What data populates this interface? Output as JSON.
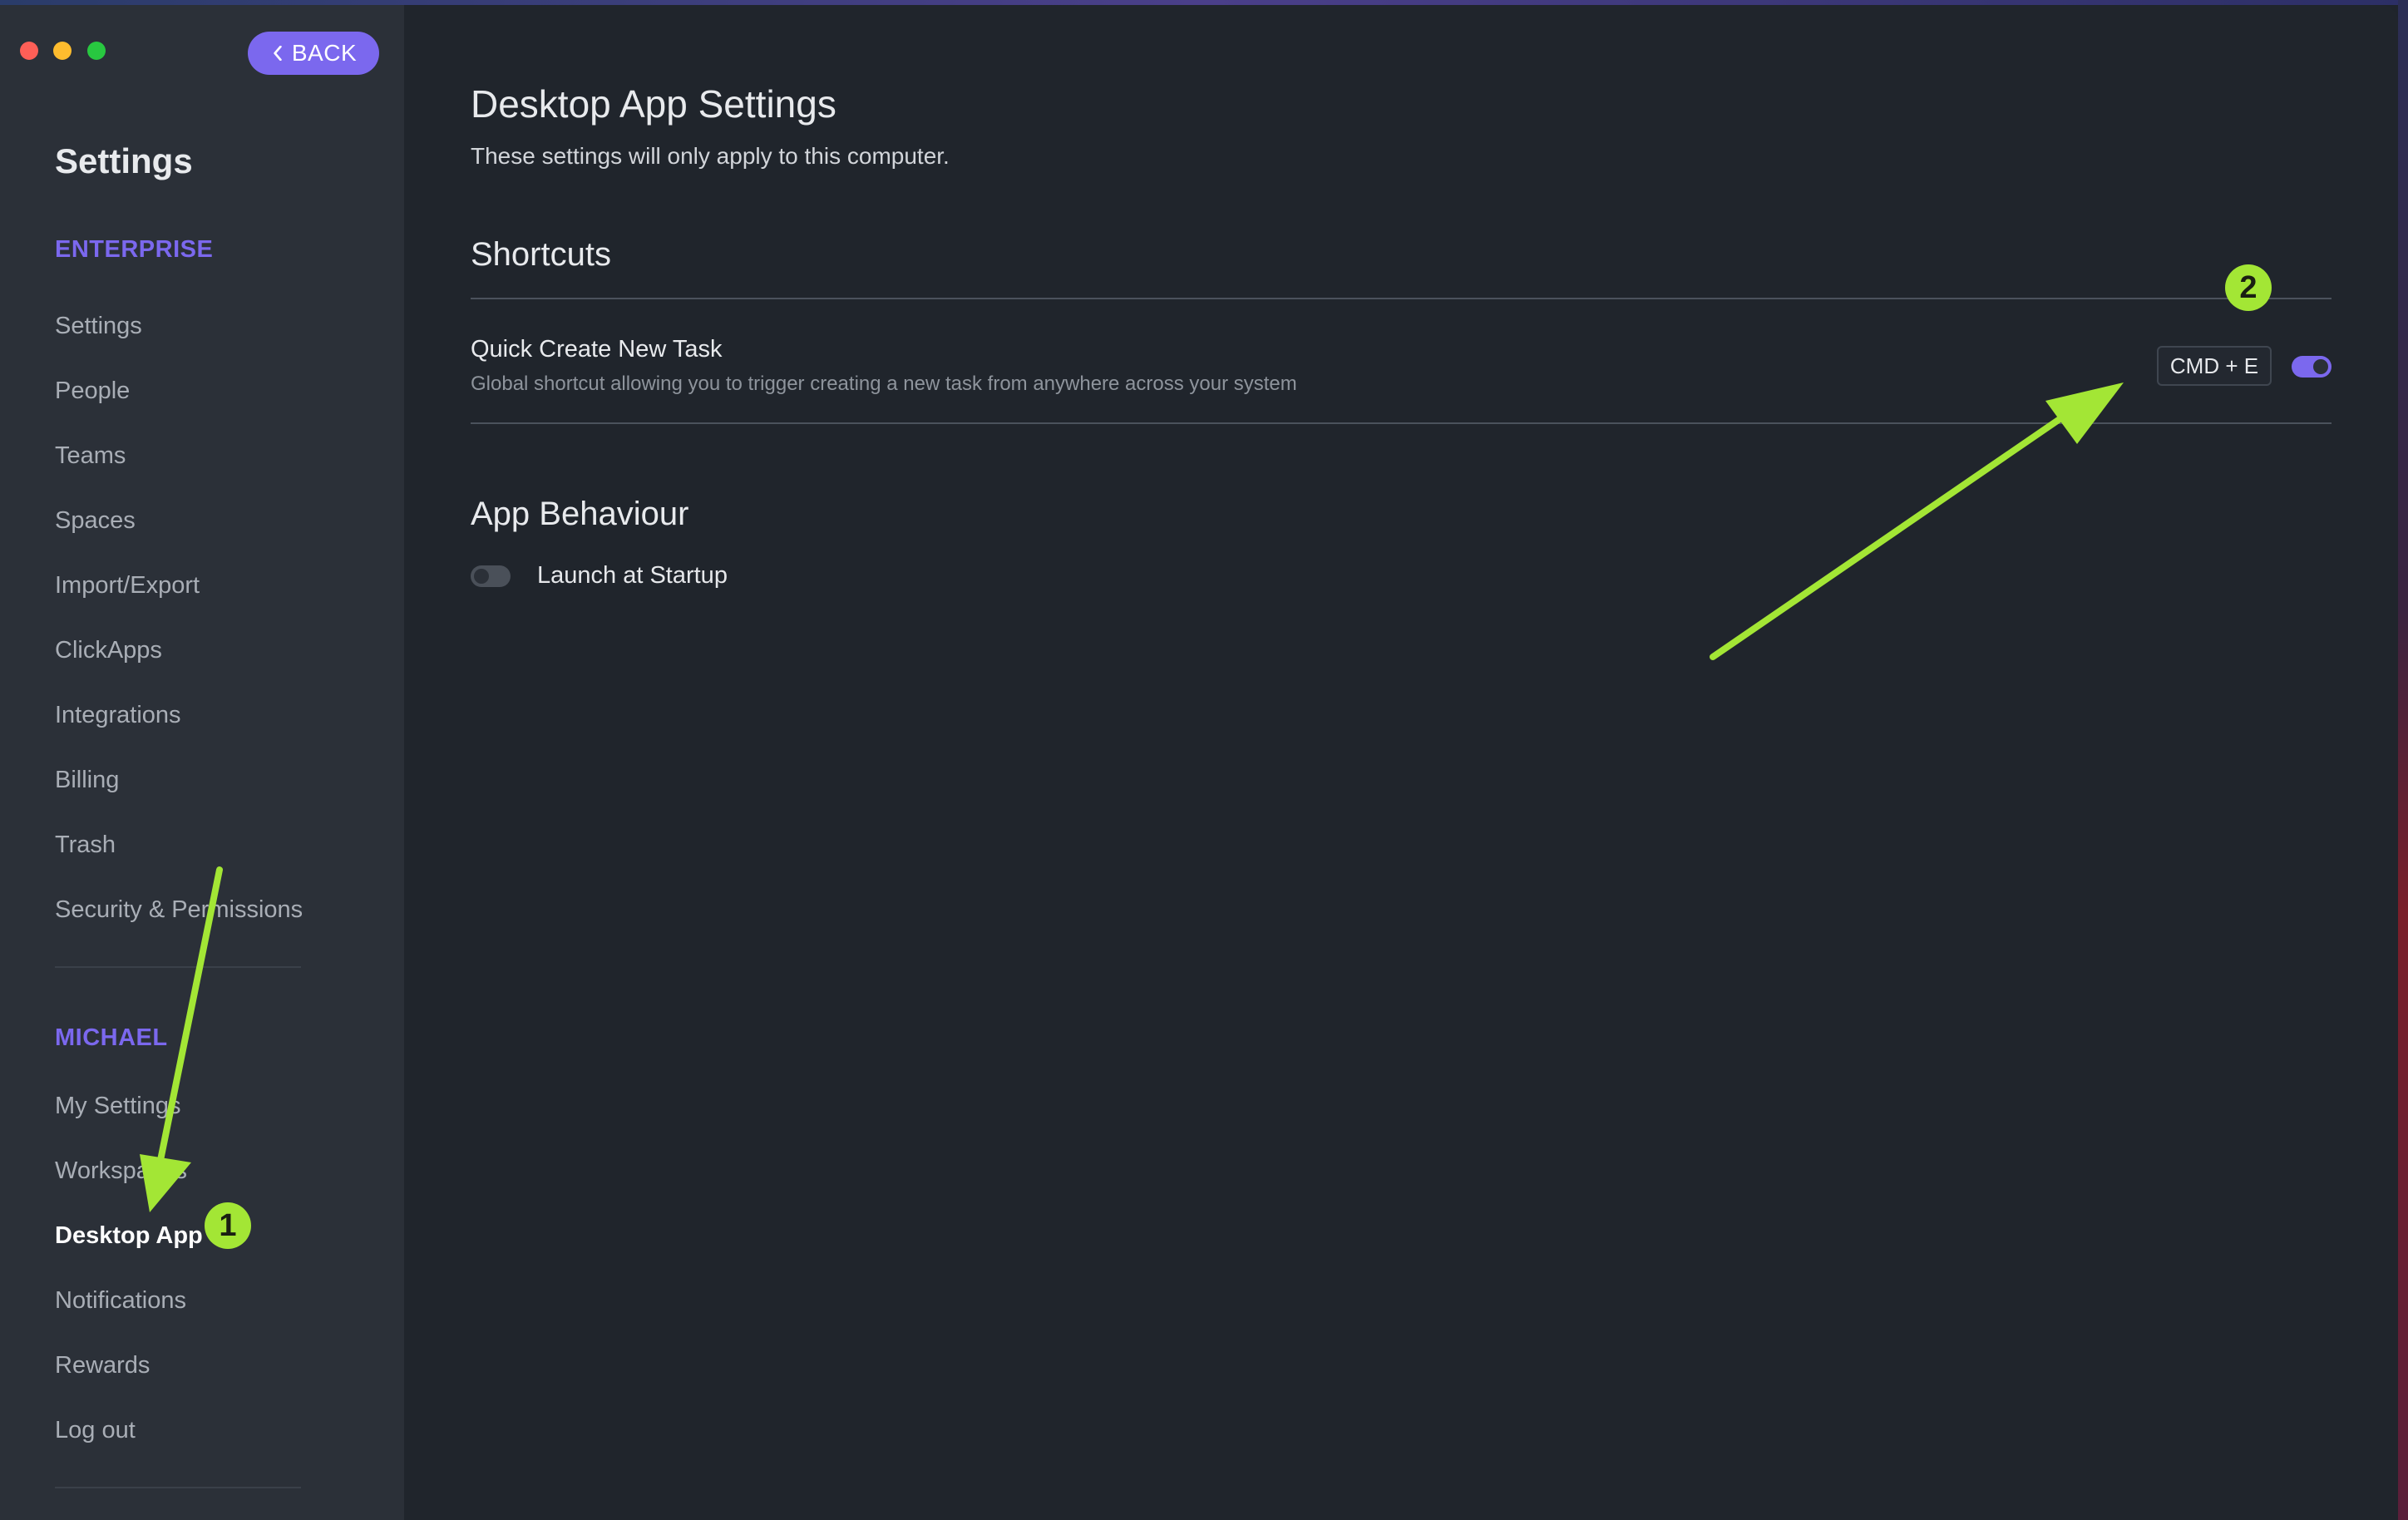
{
  "window": {
    "back_label": "BACK"
  },
  "sidebar": {
    "title": "Settings",
    "enterprise_section": "ENTERPRISE",
    "enterprise_items": [
      "Settings",
      "People",
      "Teams",
      "Spaces",
      "Import/Export",
      "ClickApps",
      "Integrations",
      "Billing",
      "Trash",
      "Security & Permissions"
    ],
    "user_section": "MICHAEL",
    "user_items": [
      "My Settings",
      "Workspaces",
      "Desktop App",
      "Notifications",
      "Rewards",
      "Log out"
    ],
    "active_item": "Desktop App"
  },
  "main": {
    "title": "Desktop App Settings",
    "subtitle": "These settings will only apply to this computer.",
    "shortcuts": {
      "heading": "Shortcuts",
      "quick_create_title": "Quick Create New Task",
      "quick_create_desc": "Global shortcut allowing you to trigger creating a new task from anywhere across your system",
      "quick_create_keys": "CMD + E",
      "quick_create_enabled": true
    },
    "behaviour": {
      "heading": "App Behaviour",
      "launch_label": "Launch at Startup",
      "launch_enabled": false
    }
  },
  "annotations": {
    "badge_1": "1",
    "badge_2": "2",
    "color": "#a3e635"
  },
  "colors": {
    "accent": "#7b68ee",
    "sidebar_bg": "#2b3038",
    "main_bg": "#20252c"
  }
}
